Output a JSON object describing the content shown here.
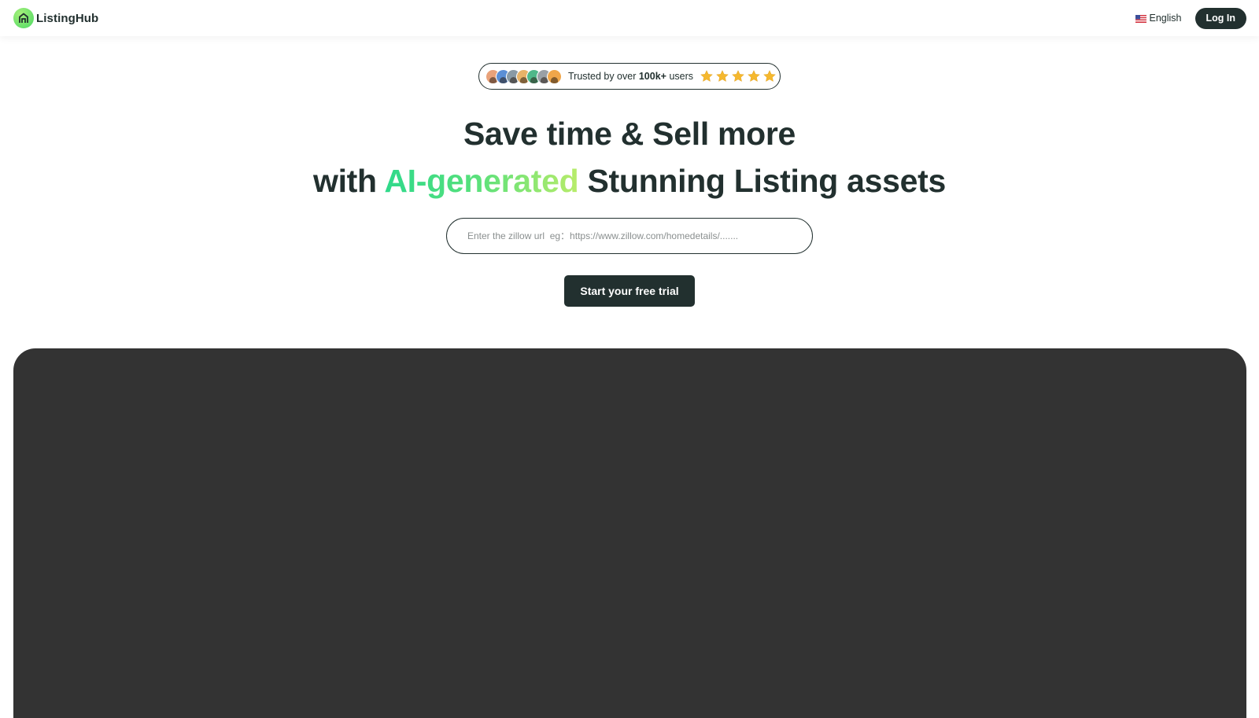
{
  "header": {
    "brand_name": "ListingHub",
    "language": "English",
    "login_label": "Log In"
  },
  "trust": {
    "prefix": "Trusted by over ",
    "highlight": "100k+",
    "suffix": " users",
    "rating_stars": 5,
    "avatar_colors": [
      "#e9a27a",
      "#5b8fd6",
      "#8a9aa5",
      "#e8b368",
      "#4fb88a",
      "#9aa0a6",
      "#f0a64a"
    ],
    "star_color": "#f5b82e"
  },
  "hero": {
    "line1": "Save time & Sell more",
    "line2_prefix": "with ",
    "line2_highlight": "AI-generated",
    "line2_suffix": " Stunning Listing assets"
  },
  "url_input": {
    "placeholder": "Enter the zillow url  eg：https://www.zillow.com/homedetails/.......",
    "value": ""
  },
  "cta": {
    "label": "Start your free trial"
  },
  "colors": {
    "primary": "#22302f",
    "panel": "#333333",
    "gradient_start": "#2fd98b",
    "gradient_end": "#b8ec6a"
  }
}
